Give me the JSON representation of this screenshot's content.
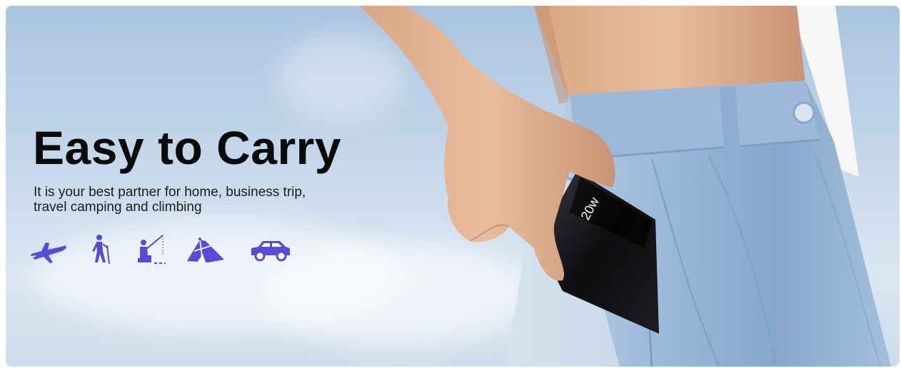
{
  "banner": {
    "headline": "Easy to Carry",
    "subline": "It is your best partner for home, business trip, travel camping and climbing",
    "device_display": "20w",
    "activity_icons": [
      {
        "name": "airplane-icon"
      },
      {
        "name": "hiking-icon"
      },
      {
        "name": "fishing-icon"
      },
      {
        "name": "tent-icon"
      },
      {
        "name": "car-icon"
      }
    ],
    "colors": {
      "icon_accent": "#5a4bd6",
      "headline": "#0a0a0a",
      "pants": "#9ab8d8",
      "sky": "#c3d6ea"
    }
  }
}
